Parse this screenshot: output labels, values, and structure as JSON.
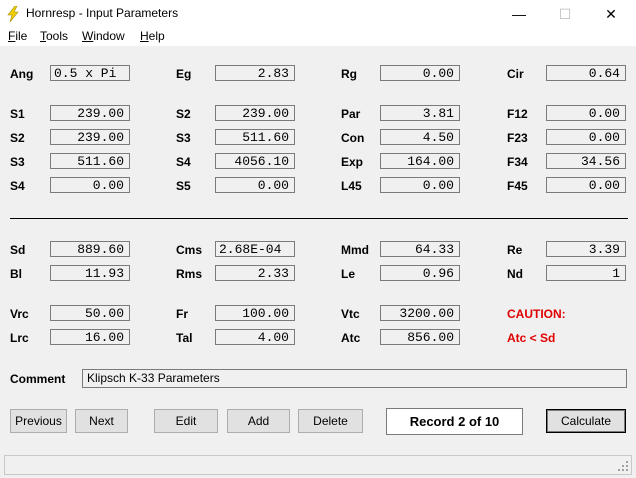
{
  "window": {
    "title": "Hornresp - Input Parameters",
    "minimize_glyph": "—",
    "maximize_glyph": "☐",
    "close_glyph": "✕",
    "icon": "lightning-icon"
  },
  "menu": [
    {
      "label_u": "F",
      "label_rest": "ile"
    },
    {
      "label_u": "T",
      "label_rest": "ools"
    },
    {
      "label_u": "W",
      "label_rest": "indow"
    },
    {
      "label_u": "H",
      "label_rest": "elp"
    }
  ],
  "params": {
    "ang": {
      "label": "Ang",
      "value": "0.5 x Pi"
    },
    "eg": {
      "label": "Eg",
      "value": "2.83"
    },
    "rg": {
      "label": "Rg",
      "value": "0.00"
    },
    "cir": {
      "label": "Cir",
      "value": "0.64"
    },
    "s1a": {
      "label": "S1",
      "value": "239.00"
    },
    "s2a": {
      "label": "S2",
      "value": "239.00"
    },
    "par": {
      "label": "Par",
      "value": "3.81"
    },
    "f12": {
      "label": "F12",
      "value": "0.00"
    },
    "s2b": {
      "label": "S2",
      "value": "239.00"
    },
    "s3a": {
      "label": "S3",
      "value": "511.60"
    },
    "con": {
      "label": "Con",
      "value": "4.50"
    },
    "f23": {
      "label": "F23",
      "value": "0.00"
    },
    "s3b": {
      "label": "S3",
      "value": "511.60"
    },
    "s4a": {
      "label": "S4",
      "value": "4056.10"
    },
    "exp": {
      "label": "Exp",
      "value": "164.00"
    },
    "f34": {
      "label": "F34",
      "value": "34.56"
    },
    "s4b": {
      "label": "S4",
      "value": "0.00"
    },
    "s5": {
      "label": "S5",
      "value": "0.00"
    },
    "l45": {
      "label": "L45",
      "value": "0.00"
    },
    "f45": {
      "label": "F45",
      "value": "0.00"
    },
    "sd": {
      "label": "Sd",
      "value": "889.60"
    },
    "cms": {
      "label": "Cms",
      "value": "2.68E-04"
    },
    "mmd": {
      "label": "Mmd",
      "value": "64.33"
    },
    "re": {
      "label": "Re",
      "value": "3.39"
    },
    "bl": {
      "label": "Bl",
      "value": "11.93"
    },
    "rms": {
      "label": "Rms",
      "value": "2.33"
    },
    "le": {
      "label": "Le",
      "value": "0.96"
    },
    "nd": {
      "label": "Nd",
      "value": "1"
    },
    "vrc": {
      "label": "Vrc",
      "value": "50.00"
    },
    "fr": {
      "label": "Fr",
      "value": "100.00"
    },
    "vtc": {
      "label": "Vtc",
      "value": "3200.00"
    },
    "lrc": {
      "label": "Lrc",
      "value": "16.00"
    },
    "tal": {
      "label": "Tal",
      "value": "4.00"
    },
    "atc": {
      "label": "Atc",
      "value": "856.00"
    }
  },
  "caution": {
    "title": "CAUTION:",
    "message": "Atc < Sd",
    "color": "#e00000"
  },
  "comment": {
    "label": "Comment",
    "value": "Klipsch K-33 Parameters"
  },
  "buttons": {
    "previous": "Previous",
    "next": "Next",
    "edit": "Edit",
    "add": "Add",
    "delete": "Delete",
    "calculate": "Calculate"
  },
  "record": "Record 2 of 10"
}
